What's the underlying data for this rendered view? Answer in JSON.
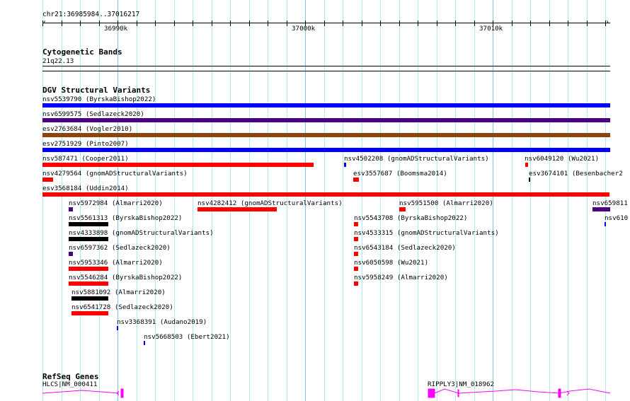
{
  "ruler": {
    "location": "chr21:36985984..37016217",
    "ticks": [
      "36990k",
      "37000k",
      "37010k"
    ]
  },
  "cytobands": {
    "title": "Cytogenetic Bands",
    "band": "21q22.13"
  },
  "dgv": {
    "title": "DGV Structural Variants",
    "colors": {
      "blue": "#0000ff",
      "purple": "#4b0082",
      "brown": "#8b4513",
      "red": "#ff0000",
      "black": "#000000"
    },
    "features": [
      {
        "label": "nsv5539790 (ByrskaBishop2022)",
        "color": "blue"
      },
      {
        "label": "nsv6599575 (Sedlazeck2020)",
        "color": "purple"
      },
      {
        "label": "esv2763684 (Vogler2010)",
        "color": "brown"
      },
      {
        "label": "esv2751929 (Pinto2007)",
        "color": "blue"
      },
      {
        "label": "nsv587471 (Cooper2011)",
        "color": "red"
      },
      {
        "label": "nsv4502208 (gnomADStructuralVariants)",
        "color": "blue"
      },
      {
        "label": "nsv6049120 (Wu2021)",
        "color": "red"
      },
      {
        "label": "nsv4279564 (gnomADStructuralVariants)",
        "color": "red"
      },
      {
        "label": "esv3557687 (Boomsma2014)",
        "color": "red"
      },
      {
        "label": "esv3674101 (Besenbacher2",
        "color": "black"
      },
      {
        "label": "esv3568184 (Uddin2014)",
        "color": "red"
      },
      {
        "label": "nsv5972984 (Almarri2020)",
        "color": "purple"
      },
      {
        "label": "nsv4282412 (gnomADStructuralVariants)",
        "color": "red"
      },
      {
        "label": "nsv5951500 (Almarri2020)",
        "color": "red"
      },
      {
        "label": "nsv659811",
        "color": "purple"
      },
      {
        "label": "nsv5561313 (ByrskaBishop2022)",
        "color": "black"
      },
      {
        "label": "nsv5543708 (ByrskaBishop2022)",
        "color": "red"
      },
      {
        "label": "nsv610",
        "color": "blue"
      },
      {
        "label": "nsv4333898 (gnomADStructuralVariants)",
        "color": "black"
      },
      {
        "label": "nsv4533315 (gnomADStructuralVariants)",
        "color": "red"
      },
      {
        "label": "nsv6597362 (Sedlazeck2020)",
        "color": "purple"
      },
      {
        "label": "nsv6543184 (Sedlazeck2020)",
        "color": "red"
      },
      {
        "label": "nsv5953346 (Almarri2020)",
        "color": "red"
      },
      {
        "label": "nsv6050598 (Wu2021)",
        "color": "red"
      },
      {
        "label": "nsv5546284 (ByrskaBishop2022)",
        "color": "red"
      },
      {
        "label": "nsv5958249 (Almarri2020)",
        "color": "red"
      },
      {
        "label": "nsv5881092 (Almarri2020)",
        "color": "black"
      },
      {
        "label": "nsv6541728 (Sedlazeck2020)",
        "color": "red"
      },
      {
        "label": "nsv3368391 (Audano2019)",
        "color": "blue"
      },
      {
        "label": "nsv5668503 (Ebert2021)",
        "color": "blue"
      }
    ]
  },
  "refseq": {
    "title": "RefSeq Genes",
    "color": "#ff00ff",
    "genes": [
      {
        "label": "HLCS|NM_000411"
      },
      {
        "label": "RIPPLY3|NM_018962"
      }
    ]
  }
}
